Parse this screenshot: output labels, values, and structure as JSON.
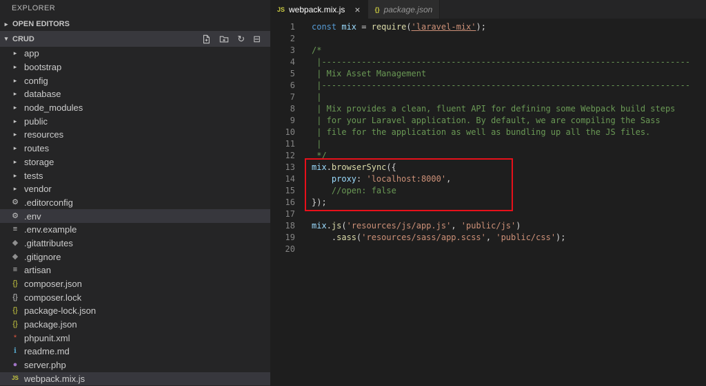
{
  "sidebar": {
    "title": "EXPLORER",
    "open_editors_label": "OPEN EDITORS",
    "folder_label": "CRUD",
    "tree": [
      {
        "label": "app",
        "kind": "folder"
      },
      {
        "label": "bootstrap",
        "kind": "folder"
      },
      {
        "label": "config",
        "kind": "folder"
      },
      {
        "label": "database",
        "kind": "folder"
      },
      {
        "label": "node_modules",
        "kind": "folder"
      },
      {
        "label": "public",
        "kind": "folder"
      },
      {
        "label": "resources",
        "kind": "folder"
      },
      {
        "label": "routes",
        "kind": "folder"
      },
      {
        "label": "storage",
        "kind": "folder"
      },
      {
        "label": "tests",
        "kind": "folder"
      },
      {
        "label": "vendor",
        "kind": "folder"
      },
      {
        "label": ".editorconfig",
        "kind": "file",
        "icon": "gear-icon",
        "glyph": "⚙",
        "color": "#c5c5c5"
      },
      {
        "label": ".env",
        "kind": "file",
        "icon": "gear-icon",
        "glyph": "⚙",
        "color": "#c5c5c5",
        "selected": true
      },
      {
        "label": ".env.example",
        "kind": "file",
        "icon": "settings-list-icon",
        "glyph": "≡",
        "color": "#c5c5c5"
      },
      {
        "label": ".gitattributes",
        "kind": "file",
        "icon": "git-icon",
        "glyph": "◆",
        "color": "#8f8f8f"
      },
      {
        "label": ".gitignore",
        "kind": "file",
        "icon": "git-icon",
        "glyph": "◆",
        "color": "#8f8f8f"
      },
      {
        "label": "artisan",
        "kind": "file",
        "icon": "settings-list-icon",
        "glyph": "≡",
        "color": "#c5c5c5"
      },
      {
        "label": "composer.json",
        "kind": "file",
        "icon": "json-braces-icon",
        "glyph": "{}",
        "color": "#cbcb41"
      },
      {
        "label": "composer.lock",
        "kind": "file",
        "icon": "json-braces-icon",
        "glyph": "{}",
        "color": "#c5c5c5"
      },
      {
        "label": "package-lock.json",
        "kind": "file",
        "icon": "json-braces-icon",
        "glyph": "{}",
        "color": "#cbcb41"
      },
      {
        "label": "package.json",
        "kind": "file",
        "icon": "json-braces-icon",
        "glyph": "{}",
        "color": "#cbcb41"
      },
      {
        "label": "phpunit.xml",
        "kind": "file",
        "icon": "phpunit-icon",
        "glyph": "*",
        "color": "#e0563e"
      },
      {
        "label": "readme.md",
        "kind": "file",
        "icon": "info-icon",
        "glyph": "ℹ",
        "color": "#519aba"
      },
      {
        "label": "server.php",
        "kind": "file",
        "icon": "php-icon",
        "glyph": "●",
        "color": "#a074c4"
      },
      {
        "label": "webpack.mix.js",
        "kind": "file",
        "icon": "js-icon",
        "glyph": "JS",
        "color": "#cbcb41",
        "selected": true
      }
    ]
  },
  "tabs": [
    {
      "label": "webpack.mix.js",
      "icon": "js-icon",
      "glyph": "JS",
      "color": "#cbcb41",
      "active": true,
      "close_label": "×"
    },
    {
      "label": "package.json",
      "icon": "json-braces-icon",
      "glyph": "{}",
      "color": "#cbcb41",
      "active": false,
      "preview": true
    }
  ],
  "editor": {
    "lines": [
      {
        "n": 1,
        "tokens": [
          [
            "const",
            "kw"
          ],
          [
            " ",
            "pun"
          ],
          [
            "mix",
            "var"
          ],
          [
            " = ",
            "pun"
          ],
          [
            "require",
            "fn"
          ],
          [
            "(",
            "pun"
          ],
          [
            "'laravel-mix'",
            "str u"
          ],
          [
            ");",
            "pun"
          ]
        ]
      },
      {
        "n": 2,
        "tokens": []
      },
      {
        "n": 3,
        "tokens": [
          [
            "/*",
            "cmt"
          ]
        ]
      },
      {
        "n": 4,
        "tokens": [
          [
            " |--------------------------------------------------------------------------",
            "cmt"
          ]
        ]
      },
      {
        "n": 5,
        "tokens": [
          [
            " | Mix Asset Management",
            "cmt"
          ]
        ]
      },
      {
        "n": 6,
        "tokens": [
          [
            " |--------------------------------------------------------------------------",
            "cmt"
          ]
        ]
      },
      {
        "n": 7,
        "tokens": [
          [
            " |",
            "cmt"
          ]
        ]
      },
      {
        "n": 8,
        "tokens": [
          [
            " | Mix provides a clean, fluent API for defining some Webpack build steps",
            "cmt"
          ]
        ]
      },
      {
        "n": 9,
        "tokens": [
          [
            " | for your Laravel application. By default, we are compiling the Sass",
            "cmt"
          ]
        ]
      },
      {
        "n": 10,
        "tokens": [
          [
            " | file for the application as well as bundling up all the JS files.",
            "cmt"
          ]
        ]
      },
      {
        "n": 11,
        "tokens": [
          [
            " |",
            "cmt"
          ]
        ]
      },
      {
        "n": 12,
        "tokens": [
          [
            " */",
            "cmt"
          ]
        ]
      },
      {
        "n": 13,
        "tokens": [
          [
            "mix",
            "var"
          ],
          [
            ".",
            "pun"
          ],
          [
            "browserSync",
            "fn"
          ],
          [
            "({",
            "pun"
          ]
        ]
      },
      {
        "n": 14,
        "tokens": [
          [
            "    ",
            "pun"
          ],
          [
            "proxy",
            "var"
          ],
          [
            ": ",
            "pun"
          ],
          [
            "'localhost:8000'",
            "str"
          ],
          [
            ",",
            "pun"
          ]
        ]
      },
      {
        "n": 15,
        "tokens": [
          [
            "    ",
            "pun"
          ],
          [
            "//open: false",
            "cmt"
          ]
        ]
      },
      {
        "n": 16,
        "tokens": [
          [
            "});",
            "pun"
          ]
        ]
      },
      {
        "n": 17,
        "tokens": []
      },
      {
        "n": 18,
        "tokens": [
          [
            "mix",
            "var"
          ],
          [
            ".",
            "pun"
          ],
          [
            "js",
            "fn"
          ],
          [
            "(",
            "pun"
          ],
          [
            "'resources/js/app.js'",
            "str"
          ],
          [
            ", ",
            "pun"
          ],
          [
            "'public/js'",
            "str"
          ],
          [
            ")",
            "pun"
          ]
        ]
      },
      {
        "n": 19,
        "tokens": [
          [
            "    .",
            "pun"
          ],
          [
            "sass",
            "fn"
          ],
          [
            "(",
            "pun"
          ],
          [
            "'resources/sass/app.scss'",
            "str"
          ],
          [
            ", ",
            "pun"
          ],
          [
            "'public/css'",
            "str"
          ],
          [
            ");",
            "pun"
          ]
        ]
      },
      {
        "n": 20,
        "tokens": []
      }
    ]
  }
}
